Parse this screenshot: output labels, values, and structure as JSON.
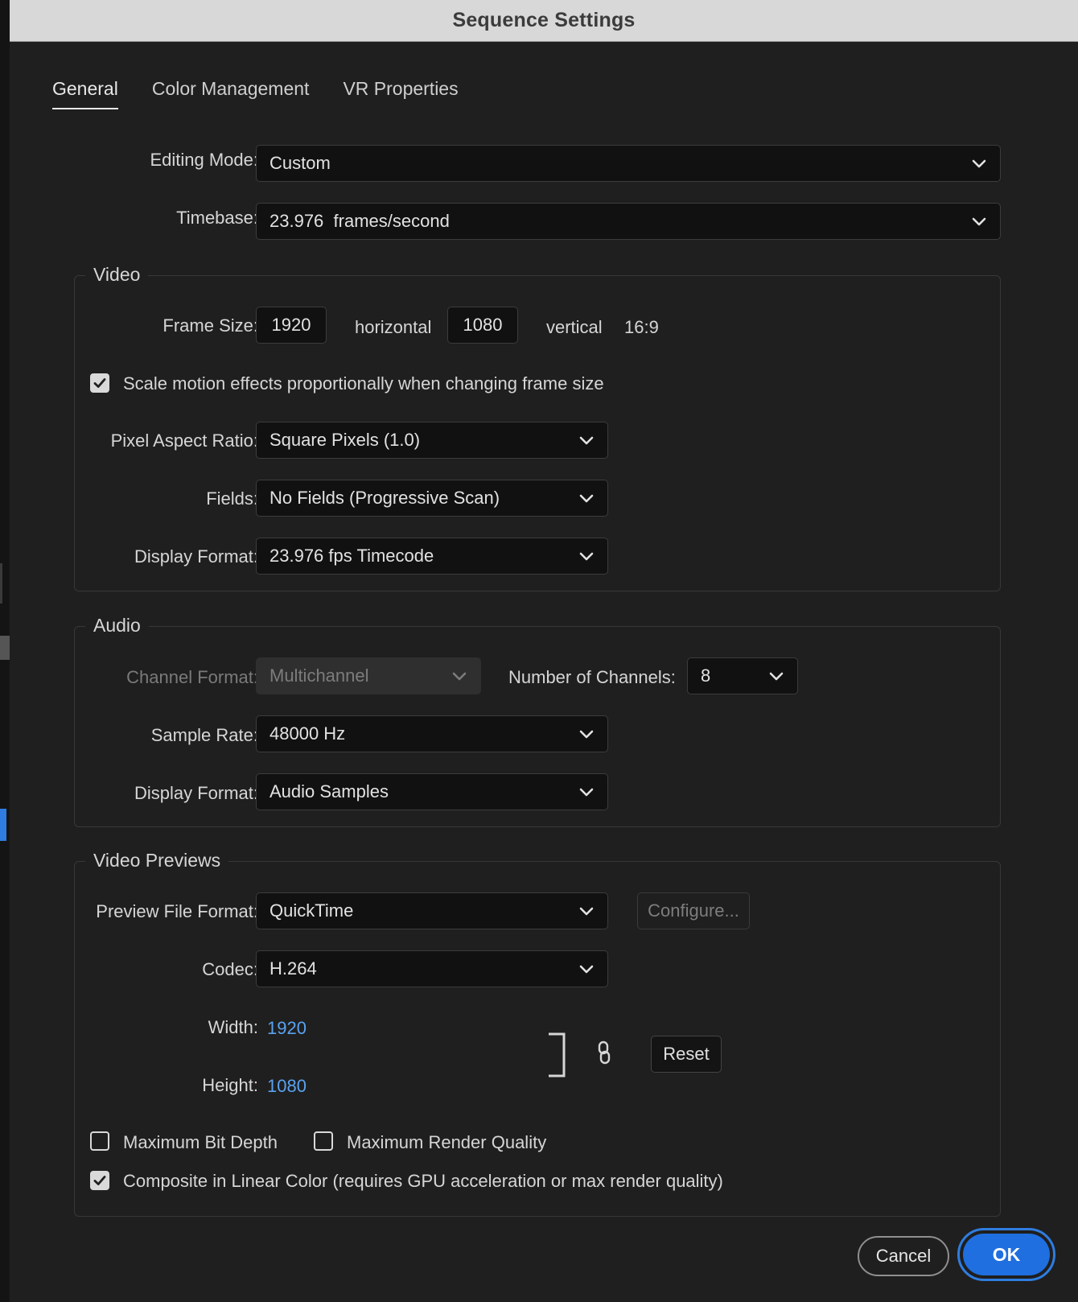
{
  "window": {
    "title": "Sequence Settings"
  },
  "tabs": [
    {
      "label": "General",
      "active": true
    },
    {
      "label": "Color Management",
      "active": false
    },
    {
      "label": "VR Properties",
      "active": false
    }
  ],
  "general": {
    "editing_mode": {
      "label": "Editing Mode:",
      "value": "Custom"
    },
    "timebase": {
      "label": "Timebase:",
      "value": "23.976  frames/second"
    }
  },
  "video": {
    "title": "Video",
    "frame_size": {
      "label": "Frame Size:",
      "horizontal": "1920",
      "horizontal_label": "horizontal",
      "vertical": "1080",
      "vertical_label": "vertical",
      "aspect": "16:9"
    },
    "scale_motion": {
      "label": "Scale motion effects proportionally when changing frame size",
      "checked": true
    },
    "pixel_aspect_ratio": {
      "label": "Pixel Aspect Ratio:",
      "value": "Square Pixels (1.0)"
    },
    "fields": {
      "label": "Fields:",
      "value": "No Fields (Progressive Scan)"
    },
    "display_format": {
      "label": "Display Format:",
      "value": "23.976 fps Timecode"
    }
  },
  "audio": {
    "title": "Audio",
    "channel_format": {
      "label": "Channel Format:",
      "value": "Multichannel",
      "disabled": true
    },
    "number_of_channels": {
      "label": "Number of Channels:",
      "value": "8"
    },
    "sample_rate": {
      "label": "Sample Rate:",
      "value": "48000 Hz"
    },
    "display_format": {
      "label": "Display Format:",
      "value": "Audio Samples"
    }
  },
  "video_previews": {
    "title": "Video Previews",
    "preview_file_format": {
      "label": "Preview File Format:",
      "value": "QuickTime"
    },
    "configure_label": "Configure...",
    "codec": {
      "label": "Codec:",
      "value": "H.264"
    },
    "width": {
      "label": "Width:",
      "value": "1920"
    },
    "height": {
      "label": "Height:",
      "value": "1080"
    },
    "reset_label": "Reset",
    "max_bit_depth": {
      "label": "Maximum Bit Depth",
      "checked": false
    },
    "max_render_quality": {
      "label": "Maximum Render Quality",
      "checked": false
    },
    "composite_linear": {
      "label": "Composite in Linear Color (requires GPU acceleration or max render quality)",
      "checked": true
    }
  },
  "footer": {
    "cancel_label": "Cancel",
    "ok_label": "OK"
  },
  "colors": {
    "accent": "#1f6fe0",
    "link": "#5aa2f0",
    "background": "#1f1f1f"
  },
  "icons": {
    "dropdown": "chevron-down-icon",
    "checkbox": "checkmark-icon",
    "link": "chain-link-icon",
    "bracket": "bracket-icon"
  }
}
